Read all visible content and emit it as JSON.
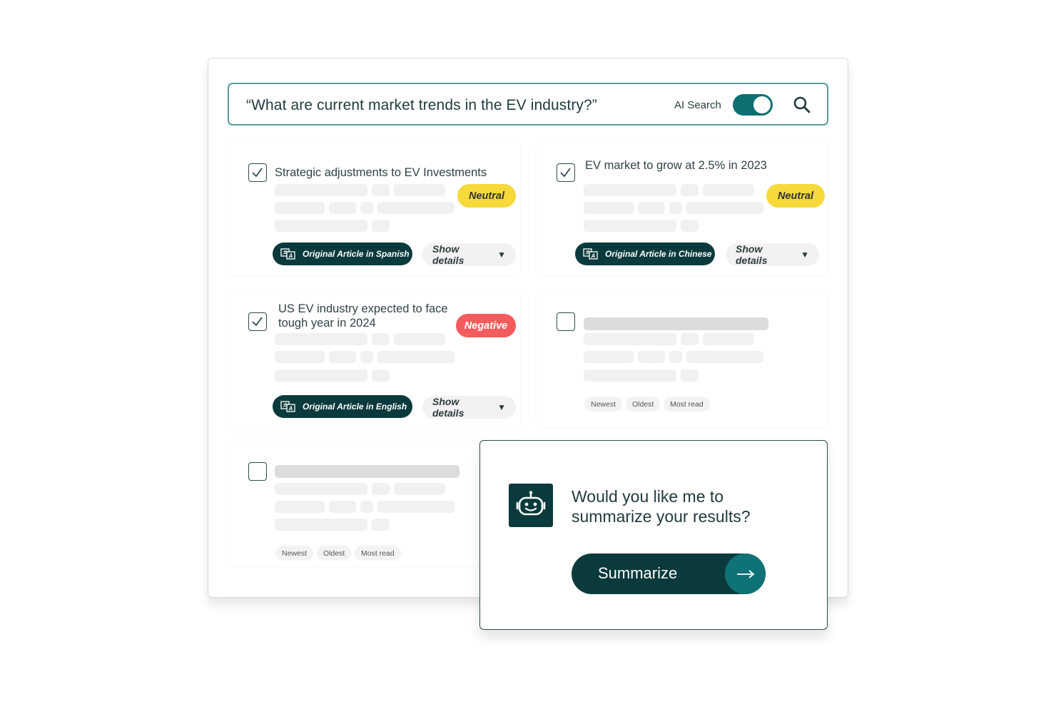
{
  "search": {
    "query": "“What are current market trends in the EV industry?”",
    "ai_label": "AI Search",
    "ai_enabled": true
  },
  "results": [
    {
      "title": "Strategic adjustments to EV Investments",
      "checked": true,
      "sentiment": "Neutral",
      "original_label": "Original Article in Spanish",
      "details_label": "Show details"
    },
    {
      "title": "EV market to grow at 2.5% in 2023",
      "checked": true,
      "sentiment": "Neutral",
      "original_label": "Original Article in Chinese",
      "details_label": "Show details"
    },
    {
      "title_line1": "US EV industry expected to face",
      "title_line2": "tough year in 2024",
      "checked": true,
      "sentiment": "Negative",
      "original_label": "Original Article in English",
      "details_label": "Show details"
    },
    {
      "checked": false,
      "chips": [
        "Newest",
        "Oldest",
        "Most read"
      ]
    },
    {
      "checked": false,
      "chips": [
        "Newest",
        "Oldest",
        "Most read"
      ]
    }
  ],
  "summary_prompt": {
    "line1": "Would you like me to",
    "line2": "summarize your results?",
    "button_label": "Summarize",
    "icon": "robot-icon"
  },
  "colors": {
    "accent": "#0e6f73",
    "dark": "#0b3a3c",
    "neutral": "#f6d93a",
    "negative": "#f25c5c"
  }
}
